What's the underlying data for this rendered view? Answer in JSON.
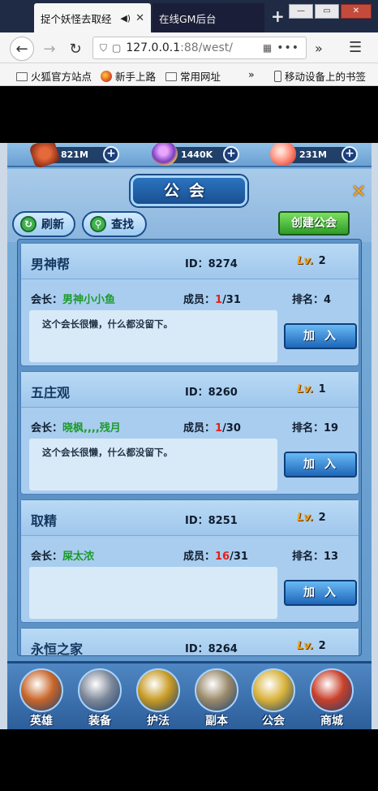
{
  "browser": {
    "active_tab": {
      "title": "捉个妖怪去取经"
    },
    "inactive_tab": {
      "title": "在线GM后台"
    },
    "url_host": "127.0.0.1",
    "url_rest": ":88/west/",
    "bookmarks": [
      "火狐官方站点",
      "新手上路",
      "常用网址",
      "移动设备上的书签"
    ]
  },
  "resources": [
    {
      "icon": "scroll-icon",
      "value": "821M"
    },
    {
      "icon": "gourd-icon",
      "value": "1440K"
    },
    {
      "icon": "peach-icon",
      "value": "231M"
    }
  ],
  "panel": {
    "title": "公会",
    "refresh_label": "刷新",
    "search_label": "查找",
    "create_label": "创建公会"
  },
  "labels": {
    "id_prefix": "ID：",
    "lv_badge": "Lv.",
    "leader_prefix": "会长：",
    "members_prefix": "成员：",
    "rank_prefix": "排名：",
    "join_label": "加入"
  },
  "guilds": [
    {
      "name": "男神帮",
      "id": "8274",
      "level": "2",
      "leader": "男神小小鱼",
      "members_current": "1",
      "members_max": "/31",
      "rank": "4",
      "desc": "这个会长很懒，什么都没留下。"
    },
    {
      "name": "五庄观",
      "id": "8260",
      "level": "1",
      "leader": "晓枫,,,,残月",
      "members_current": "1",
      "members_max": "/30",
      "rank": "19",
      "desc": "这个会长很懒，什么都没留下。"
    },
    {
      "name": "取精",
      "id": "8251",
      "level": "2",
      "leader": "屎太浓",
      "members_current": "16",
      "members_max": "/31",
      "rank": "13",
      "desc": ""
    },
    {
      "name": "永恒之家",
      "id": "8264",
      "level": "2",
      "leader": "",
      "members_current": "",
      "members_max": "",
      "rank": "",
      "desc": ""
    }
  ],
  "bottom_nav": [
    {
      "label": "英雄",
      "icon": "hero-icon",
      "color": "#c8662a"
    },
    {
      "label": "装备",
      "icon": "equipment-icon",
      "color": "#7d8899"
    },
    {
      "label": "护法",
      "icon": "guardian-icon",
      "color": "#c79a24"
    },
    {
      "label": "副本",
      "icon": "dungeon-icon",
      "color": "#9a8a6a"
    },
    {
      "label": "公会",
      "icon": "guild-icon",
      "color": "#d9b23a"
    },
    {
      "label": "商城",
      "icon": "shop-icon",
      "color": "#c8402a"
    }
  ]
}
